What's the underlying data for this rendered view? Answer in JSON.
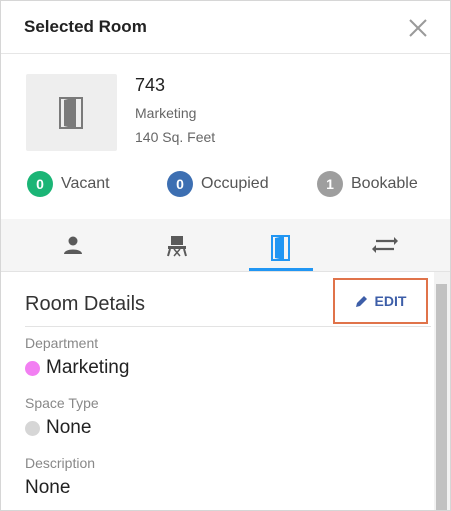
{
  "header": {
    "title": "Selected Room"
  },
  "room": {
    "number": "743",
    "department": "Marketing",
    "size": "140 Sq. Feet"
  },
  "stats": [
    {
      "count": "0",
      "label": "Vacant",
      "color": "#1bb576"
    },
    {
      "count": "0",
      "label": "Occupied",
      "color": "#3d6fb2"
    },
    {
      "count": "1",
      "label": "Bookable",
      "color": "#9e9e9e"
    }
  ],
  "tabs": [
    {
      "icon": "person-icon"
    },
    {
      "icon": "chair-icon"
    },
    {
      "icon": "door-icon",
      "active": true
    },
    {
      "icon": "swap-arrows-icon"
    }
  ],
  "details": {
    "title": "Room Details",
    "edit_label": "EDIT",
    "fields": [
      {
        "label": "Department",
        "value": "Marketing",
        "dot_color": "#f27ff2"
      },
      {
        "label": "Space Type",
        "value": "None",
        "dot_color": "#d6d6d6"
      },
      {
        "label": "Description",
        "value": "None"
      }
    ]
  },
  "colors": {
    "accent": "#2196f3",
    "edit_text": "#3d5ea8",
    "edit_highlight_border": "#e0734a"
  }
}
